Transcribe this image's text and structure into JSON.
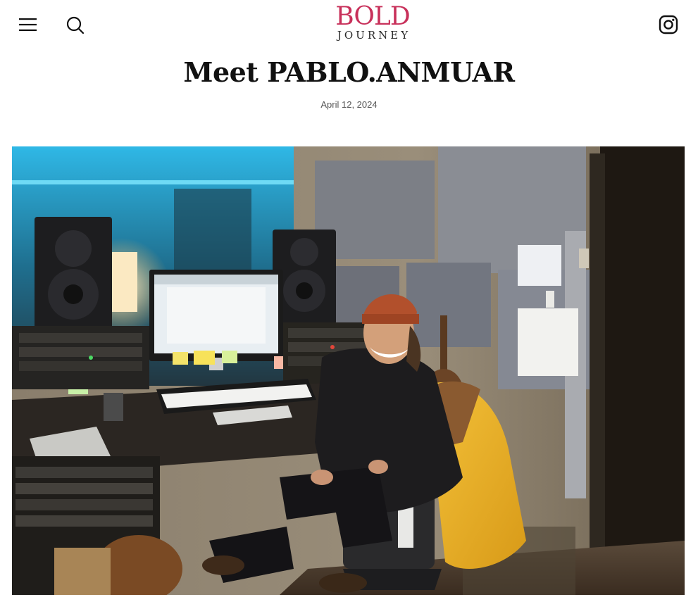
{
  "header": {
    "logo": {
      "top": "BOLD",
      "bottom": "JOURNEY"
    },
    "icons": {
      "menu": "hamburger-menu-icon",
      "search": "search-icon",
      "social": "instagram-icon"
    },
    "colors": {
      "logo_accent": "#c8305a",
      "text": "#111111"
    }
  },
  "article": {
    "title": "Meet PABLO.ANMUAR",
    "date": "April 12, 2024"
  },
  "hero_image": {
    "subject": "studio-photo"
  }
}
